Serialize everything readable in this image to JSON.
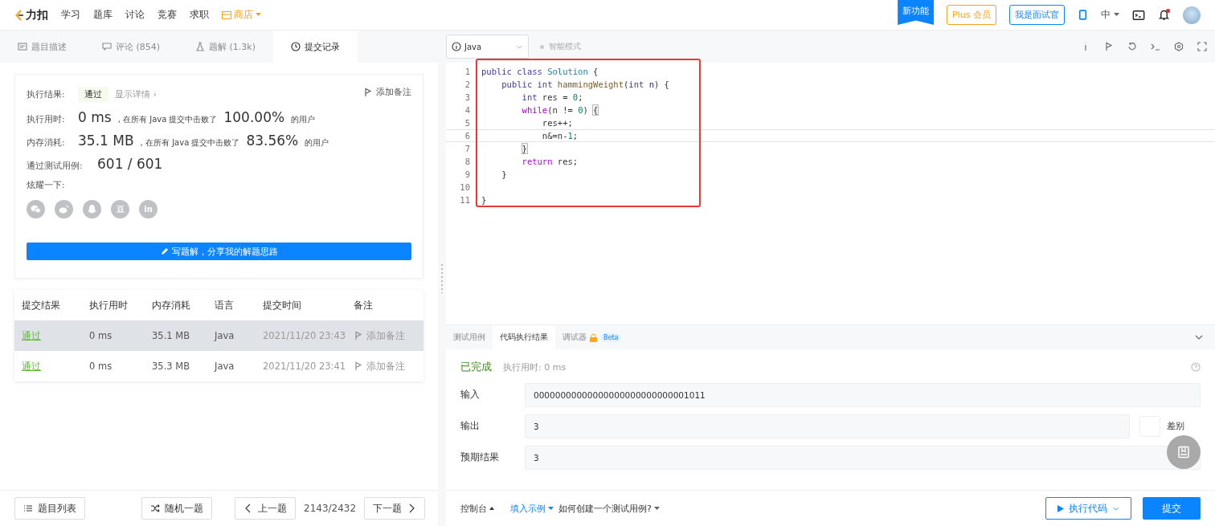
{
  "nav": {
    "logo": "力扣",
    "items": [
      "学习",
      "题库",
      "讨论",
      "竞赛",
      "求职"
    ],
    "shop": "商店",
    "new_badge": "新功能",
    "plus": "Plus 会员",
    "interviewer": "我是面试官",
    "lang": "中"
  },
  "tabs": [
    {
      "label": "题目描述",
      "selected": false,
      "kind": "doc"
    },
    {
      "label": "评论 (854)",
      "selected": false,
      "kind": "comment"
    },
    {
      "label": "题解 (1.3k)",
      "selected": false,
      "kind": "flask"
    },
    {
      "label": "提交记录",
      "selected": true,
      "kind": "clock"
    }
  ],
  "editor_toolbar": {
    "language": "Java",
    "mode": "智能模式"
  },
  "result": {
    "status_label": "执行结果:",
    "status": "通过",
    "details": "显示详情 ›",
    "add_note": "添加备注",
    "time_label": "执行用时:",
    "time": "0 ms",
    "time_text": ", 在所有 Java 提交中击败了",
    "time_pct": "100.00%",
    "time_suffix": "的用户",
    "mem_label": "内存消耗:",
    "mem": "35.1 MB",
    "mem_text": ", 在所有 Java 提交中击败了",
    "mem_pct": "83.56%",
    "mem_suffix": "的用户",
    "cases_label": "通过测试用例:",
    "cases": "601 / 601",
    "share_label": "炫耀一下:",
    "share": [
      {
        "kind": "wechat"
      },
      {
        "kind": "weibo"
      },
      {
        "kind": "qq"
      },
      {
        "kind": "douban",
        "label": "豆"
      },
      {
        "kind": "linkedin",
        "label": "in"
      }
    ],
    "write_button": "写题解，分享我的解题思路"
  },
  "submissions": {
    "columns": [
      "提交结果",
      "执行用时",
      "内存消耗",
      "语言",
      "提交时间",
      "备注"
    ],
    "rows": [
      {
        "result": "通过",
        "time": "0 ms",
        "memory": "35.1 MB",
        "language": "Java",
        "submitted": "2021/11/20 23:43",
        "note": "添加备注",
        "selected": true
      },
      {
        "result": "通过",
        "time": "0 ms",
        "memory": "35.3 MB",
        "language": "Java",
        "submitted": "2021/11/20 23:41",
        "note": "添加备注",
        "selected": false
      }
    ]
  },
  "left_footer": {
    "list": "题目列表",
    "random": "随机一题",
    "prev": "上一题",
    "counter": "2143/2432",
    "next": "下一题"
  },
  "code": [
    {
      "number": "1",
      "current": false,
      "tokens": [
        {
          "text": "public class ",
          "kind": "kw"
        },
        {
          "text": "Solution",
          "kind": "cls"
        },
        {
          "text": " {",
          "kind": "plain"
        }
      ]
    },
    {
      "number": "2",
      "current": false,
      "tokens": [
        {
          "text": "    public int ",
          "kind": "kw"
        },
        {
          "text": "hammingWeight",
          "kind": "fn"
        },
        {
          "text": "(",
          "kind": "plain"
        },
        {
          "text": "int ",
          "kind": "kw"
        },
        {
          "text": "n",
          "kind": "param"
        },
        {
          "text": ") {",
          "kind": "plain"
        }
      ]
    },
    {
      "number": "3",
      "current": false,
      "tokens": [
        {
          "text": "        int ",
          "kind": "kw"
        },
        {
          "text": "res = ",
          "kind": "plain"
        },
        {
          "text": "0",
          "kind": "num"
        },
        {
          "text": ";",
          "kind": "plain"
        }
      ]
    },
    {
      "number": "4",
      "current": false,
      "tokens": [
        {
          "text": "        while",
          "kind": "ctl"
        },
        {
          "text": "(n != ",
          "kind": "plain"
        },
        {
          "text": "0",
          "kind": "num"
        },
        {
          "text": ") ",
          "kind": "plain"
        },
        {
          "text": "{",
          "kind": "match"
        }
      ]
    },
    {
      "number": "5",
      "current": false,
      "tokens": [
        {
          "text": "            res++;",
          "kind": "plain"
        }
      ]
    },
    {
      "number": "6",
      "current": true,
      "tokens": [
        {
          "text": "            n&=n-",
          "kind": "plain"
        },
        {
          "text": "1",
          "kind": "num"
        },
        {
          "text": ";",
          "kind": "plain"
        }
      ]
    },
    {
      "number": "7",
      "current": false,
      "tokens": [
        {
          "text": "        }",
          "kind": "match"
        }
      ]
    },
    {
      "number": "8",
      "current": false,
      "tokens": [
        {
          "text": "        return ",
          "kind": "ctl"
        },
        {
          "text": "res;",
          "kind": "plain"
        }
      ]
    },
    {
      "number": "9",
      "current": false,
      "tokens": [
        {
          "text": "    }",
          "kind": "plain"
        }
      ]
    },
    {
      "number": "10",
      "current": false
    },
    {
      "number": "11",
      "current": false,
      "tokens": [
        {
          "text": "}",
          "kind": "plain"
        }
      ]
    }
  ],
  "console_tabs": [
    {
      "label": "测试用例",
      "selected": false
    },
    {
      "label": "代码执行结果",
      "selected": true
    },
    {
      "label": "调试器",
      "selected": false,
      "locked": true,
      "badge": "Beta"
    }
  ],
  "run": {
    "state": "已完成",
    "time": "执行用时:  0 ms",
    "fields": [
      {
        "label": "输入",
        "value": "00000000000000000000000000001011"
      },
      {
        "label": "输出",
        "value": "3",
        "diff": {
          "label": "差别",
          "checked": false
        }
      },
      {
        "label": "预期结果",
        "value": "3"
      }
    ]
  },
  "right_footer": {
    "console": "控制台",
    "example": "填入示例",
    "howto": "如何创建一个测试用例?",
    "run": "执行代码",
    "submit": "提交"
  }
}
